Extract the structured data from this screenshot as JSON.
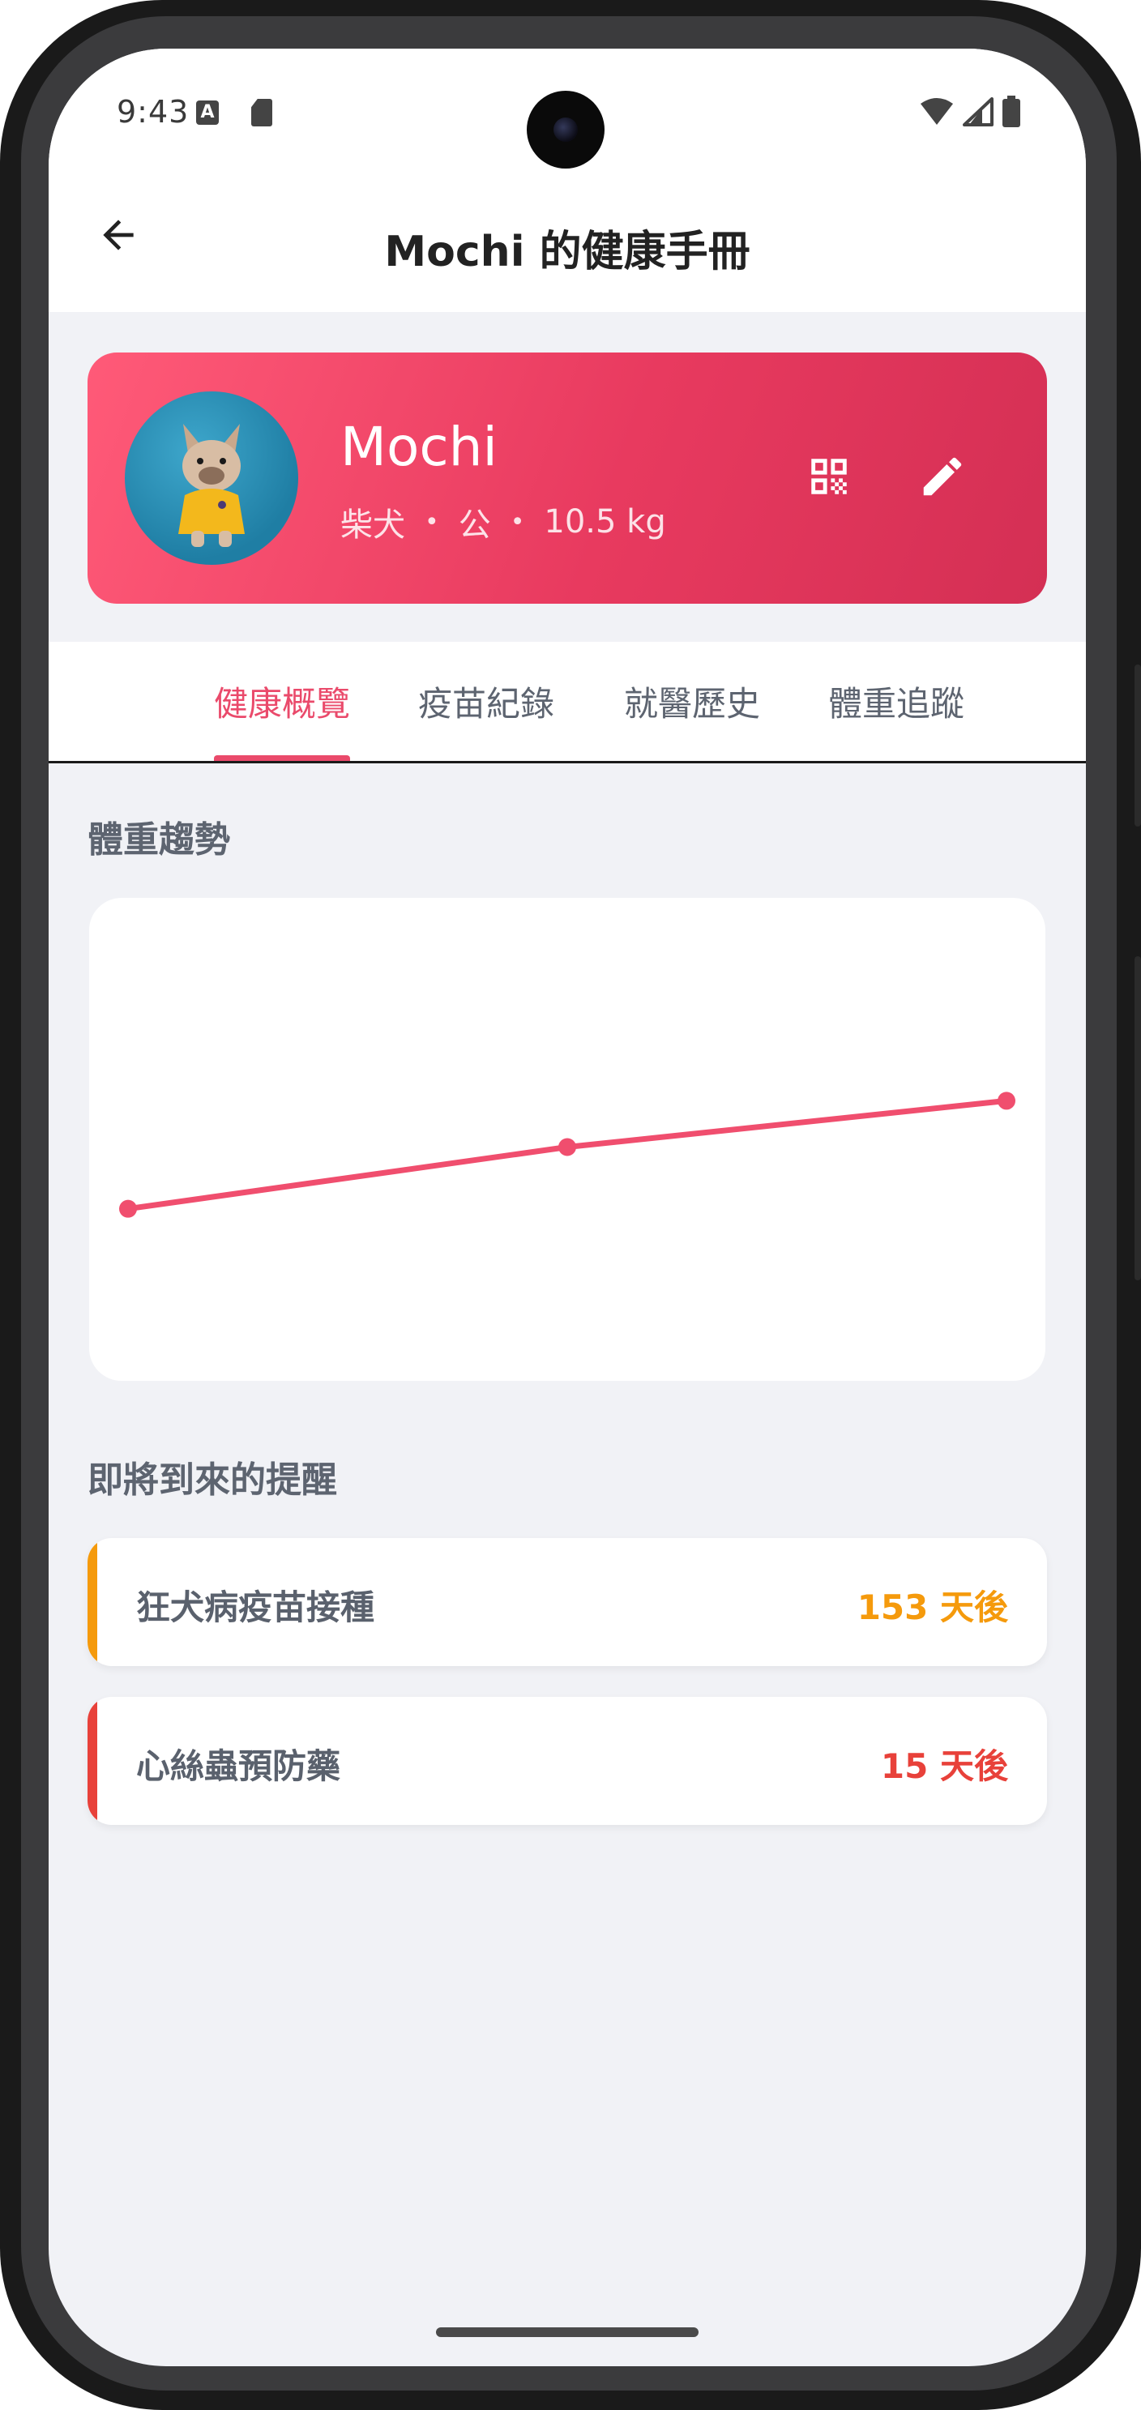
{
  "status_bar": {
    "time": "9:43",
    "a_badge": "A"
  },
  "app_bar": {
    "title": "Mochi 的健康手冊"
  },
  "profile": {
    "name": "Mochi",
    "breed": "柴犬",
    "sex": "公",
    "weight": "10.5 kg",
    "separator": "•"
  },
  "tabs": [
    {
      "label": "健康概覽",
      "active": true
    },
    {
      "label": "疫苗紀錄",
      "active": false
    },
    {
      "label": "就醫歷史",
      "active": false
    },
    {
      "label": "體重追蹤",
      "active": false
    }
  ],
  "weight_section": {
    "title": "體重趨勢"
  },
  "chart_data": {
    "type": "line",
    "title": "",
    "xlabel": "",
    "ylabel": "",
    "grid": false,
    "legend": "none",
    "series": [
      {
        "color": "#f04e6e",
        "values": [
          9.8,
          10.2,
          10.5
        ]
      }
    ],
    "ylim": [
      9.0,
      11.5
    ]
  },
  "reminders_section": {
    "title": "即將到來的提醒",
    "items": [
      {
        "title": "狂犬病疫苗接種",
        "days": "153 天後",
        "color": "#f59a0c"
      },
      {
        "title": "心絲蟲預防藥",
        "days": "15 天後",
        "color": "#e8413a"
      }
    ]
  },
  "colors": {
    "accent": "#ea4a6b",
    "background": "#f1f2f6"
  }
}
